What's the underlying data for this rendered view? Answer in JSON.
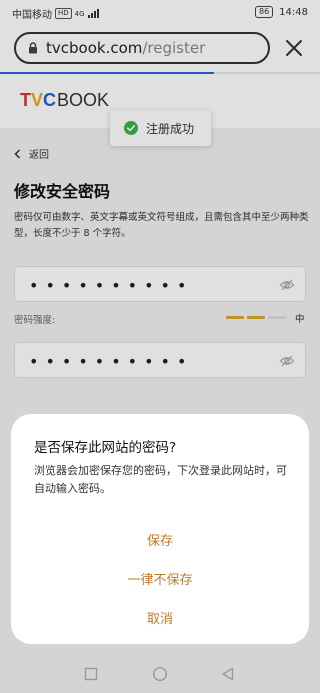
{
  "statusbar": {
    "carrier": "中国移动",
    "hd_badge": "HD",
    "network": "4G",
    "battery": "86",
    "time": "14:48"
  },
  "browser": {
    "url_host": "tvcbook.com",
    "url_path": "/register",
    "load_progress": 0.67,
    "lock_icon": "lock-icon",
    "close_icon": "close-icon"
  },
  "header": {
    "logo": {
      "t": "T",
      "v": "V",
      "c": "C",
      "rest": "BOOK"
    }
  },
  "toast": {
    "text": "注册成功",
    "icon": "check-circle-icon",
    "icon_color": "#3cb34a"
  },
  "page": {
    "back_label": "返回",
    "title": "修改安全密码",
    "hint": "密码仅可由数字、英文字幕或英文符号组成，且需包含其中至少两种类型，长度不少于 8 个字符。",
    "password_value": "••••••••••",
    "confirm_value": "••••••••••",
    "strength_label": "密码强度:",
    "strength_text": "中",
    "strength_level": 2,
    "strength_max": 3,
    "strength_color_active": "#d6aa2a",
    "strength_color_inactive": "#dddddd"
  },
  "dialog": {
    "title": "是否保存此网站的密码?",
    "message": "浏览器会加密保存您的密码，下次登录此网站时，可自动输入密码。",
    "save": "保存",
    "never_save": "一律不保存",
    "cancel": "取消",
    "accent": "#c07a2c"
  },
  "navbar": {
    "back_icon": "nav-back-icon",
    "home_icon": "nav-home-icon",
    "recents_icon": "nav-recents-icon"
  }
}
